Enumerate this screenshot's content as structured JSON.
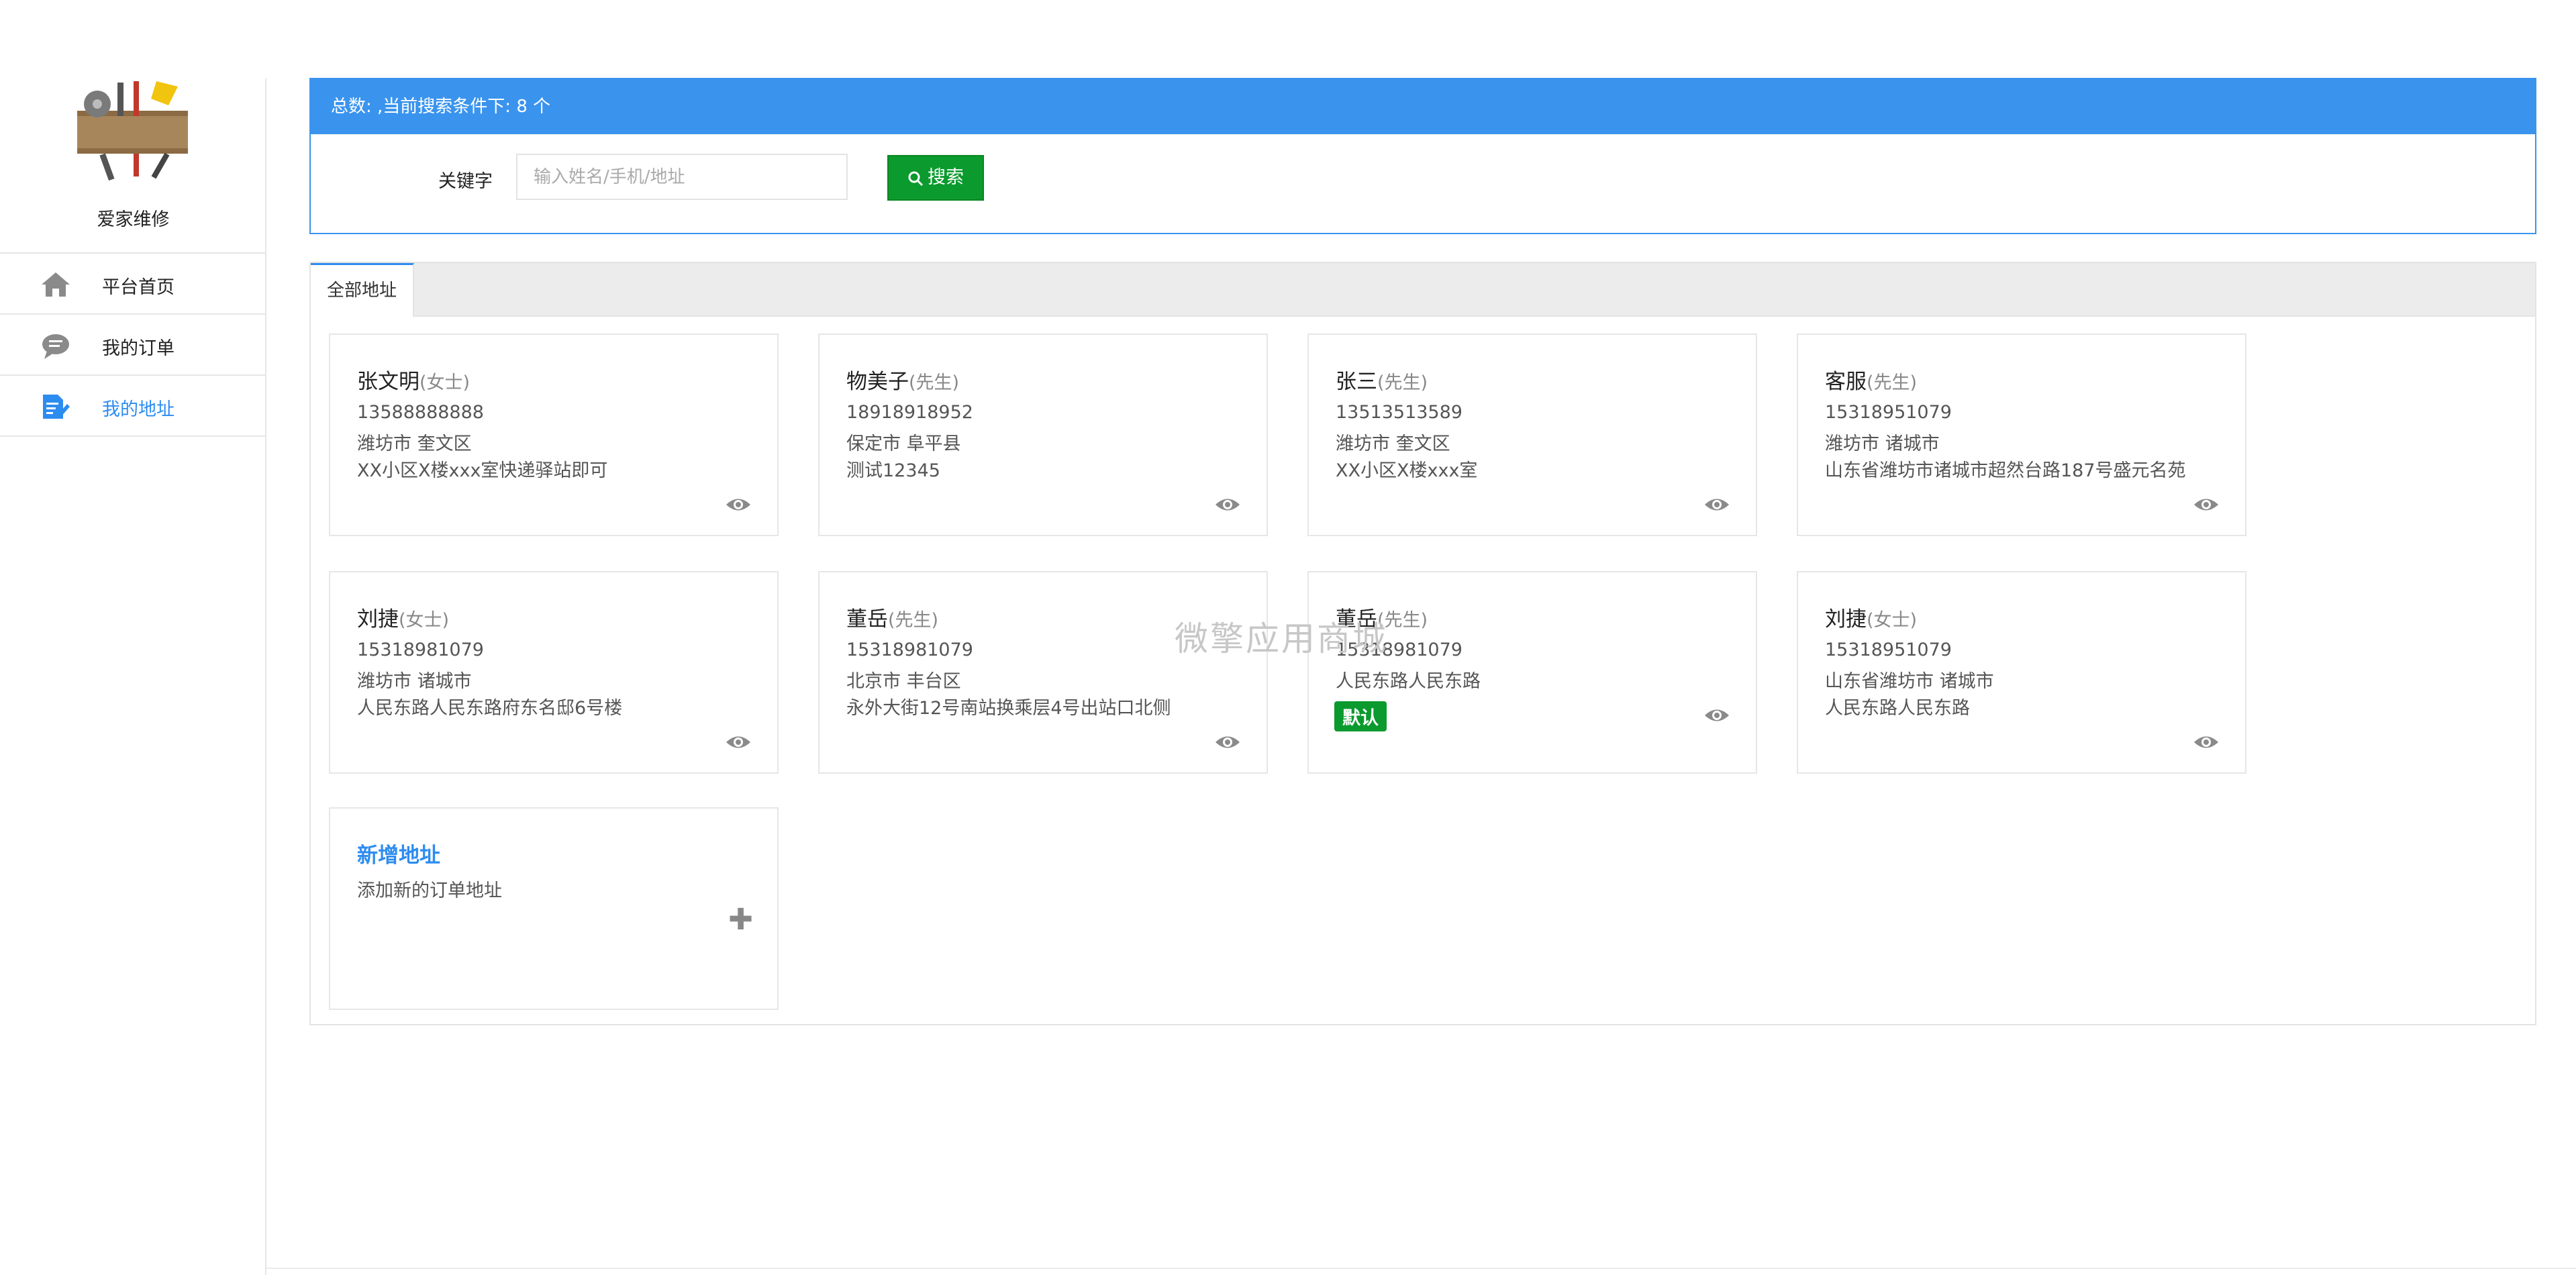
{
  "sidebar": {
    "brand": "爱家维修",
    "items": [
      {
        "label": "平台首页",
        "icon": "home-icon",
        "active": false
      },
      {
        "label": "我的订单",
        "icon": "chat-icon",
        "active": false
      },
      {
        "label": "我的地址",
        "icon": "edit-document-icon",
        "active": true
      }
    ]
  },
  "search": {
    "summary": "总数: ,当前搜索条件下: 8 个",
    "keyword_label": "关键字",
    "placeholder": "输入姓名/手机/地址",
    "button_label": "搜索"
  },
  "tabs": [
    {
      "label": "全部地址"
    }
  ],
  "addresses": [
    {
      "name": "张文明",
      "salutation": "(女士)",
      "phone": "13588888888",
      "region": "潍坊市 奎文区",
      "detail": "XX小区X楼xxx室快递驿站即可"
    },
    {
      "name": "物美子",
      "salutation": "(先生)",
      "phone": "18918918952",
      "region": "保定市 阜平县",
      "detail": "测试12345"
    },
    {
      "name": "张三",
      "salutation": "(先生)",
      "phone": "13513513589",
      "region": "潍坊市 奎文区",
      "detail": "XX小区X楼xxx室"
    },
    {
      "name": "客服",
      "salutation": "(先生)",
      "phone": "15318951079",
      "region": "潍坊市 诸城市",
      "detail": "山东省潍坊市诸城市超然台路187号盛元名苑"
    },
    {
      "name": "刘捷",
      "salutation": "(女士)",
      "phone": "15318981079",
      "region": "潍坊市 诸城市",
      "detail": "人民东路人民东路府东名邸6号楼"
    },
    {
      "name": "董岳",
      "salutation": "(先生)",
      "phone": "15318981079",
      "region": "北京市 丰台区",
      "detail": "永外大街12号南站换乘层4号出站口北侧"
    },
    {
      "name": "董岳",
      "salutation": "(先生)",
      "phone": "15318981079",
      "region": "人民东路人民东路",
      "default_badge": "默认"
    },
    {
      "name": "刘捷",
      "salutation": "(女士)",
      "phone": "15318951079",
      "region": "山东省潍坊市 诸城市",
      "detail": "人民东路人民东路"
    }
  ],
  "add_card": {
    "title": "新增地址",
    "subtitle": "添加新的订单地址",
    "icon": "plus-icon"
  },
  "watermark": "微擎应用商城",
  "colors": {
    "primary_blue": "#3a94ee",
    "active_link": "#2d8cf0",
    "search_green": "#0b9a2e"
  }
}
